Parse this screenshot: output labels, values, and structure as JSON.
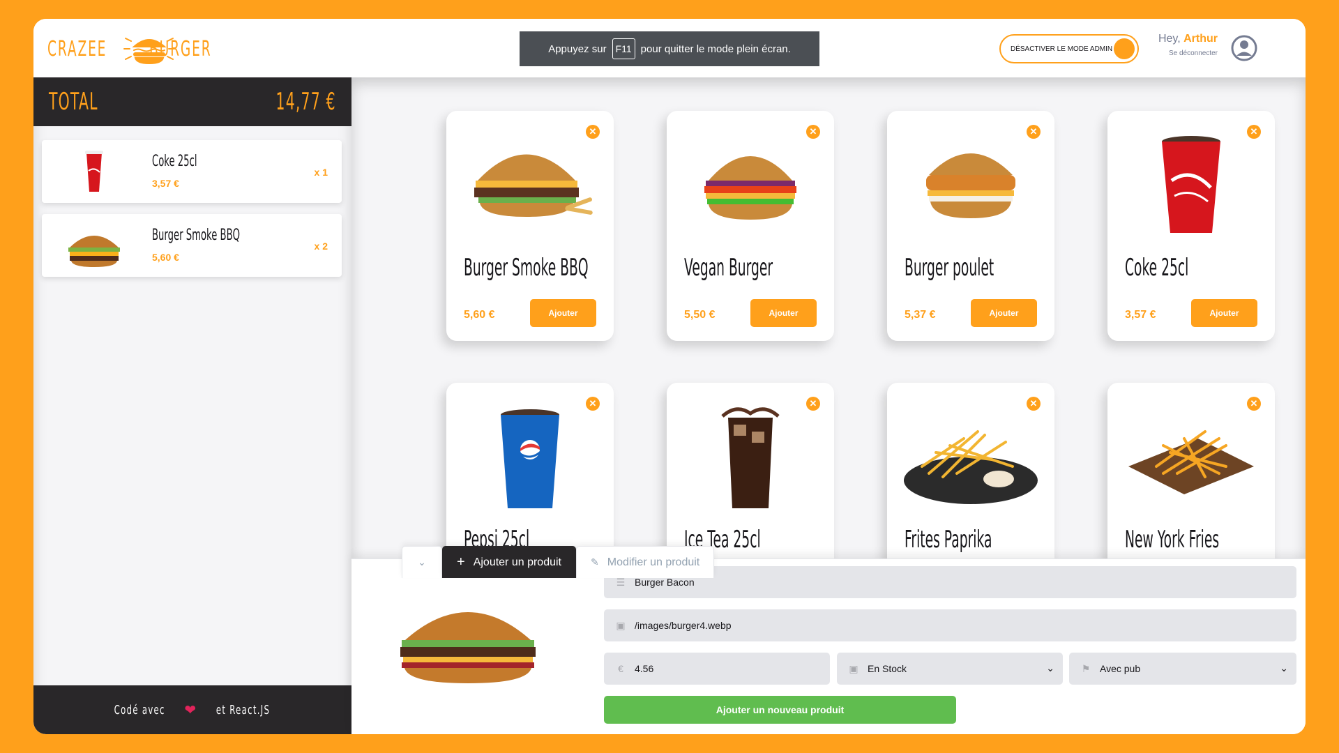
{
  "brand": {
    "left": "CRAZEE",
    "right": "BURGER"
  },
  "fullscreen_notice": {
    "before": "Appuyez sur",
    "key": "F11",
    "after": "pour quitter le mode plein écran."
  },
  "admin_toggle": {
    "label": "DÉSACTIVER LE MODE ADMIN",
    "on": true
  },
  "profile": {
    "greeting": "Hey,",
    "name": "Arthur",
    "logout": "Se déconnecter"
  },
  "basket": {
    "total_label": "TOTAL",
    "total_amount": "14,77 €",
    "items": [
      {
        "title": "Coke 25cl",
        "price": "3,57 €",
        "qty": "x 1",
        "icon": "coke-cup"
      },
      {
        "title": "Burger Smoke BBQ",
        "price": "5,60 €",
        "qty": "x 2",
        "icon": "burger"
      }
    ],
    "footer_left": "Codé avec",
    "footer_right": "et React.JS"
  },
  "menu": {
    "add_label": "Ajouter",
    "products": [
      {
        "title": "Burger Smoke BBQ",
        "price": "5,60 €",
        "icon": "burger-bbq"
      },
      {
        "title": "Vegan Burger",
        "price": "5,50 €",
        "icon": "vegan-burger"
      },
      {
        "title": "Burger poulet",
        "price": "5,37 €",
        "icon": "chicken-burger"
      },
      {
        "title": "Coke 25cl",
        "price": "3,57 €",
        "icon": "coke-cup"
      },
      {
        "title": "Pepsi 25cl",
        "price": "",
        "icon": "pepsi-cup"
      },
      {
        "title": "Ice Tea 25cl",
        "price": "",
        "icon": "iced-glass"
      },
      {
        "title": "Frites Paprika",
        "price": "",
        "icon": "fries-plate"
      },
      {
        "title": "New York Fries",
        "price": "",
        "icon": "fries-board"
      }
    ]
  },
  "admin_panel": {
    "tabs": {
      "collapse": "chevron-down",
      "add": "Ajouter un produit",
      "edit": "Modifier un produit"
    },
    "form": {
      "name": "Burger Bacon",
      "image_url": "/images/burger4.webp",
      "price": "4.56",
      "stock": "En Stock",
      "pub": "Avec pub"
    },
    "submit_label": "Ajouter un nouveau produit"
  },
  "colors": {
    "primary": "#FFA01B",
    "dark": "#292729",
    "success": "#60BD4F"
  }
}
